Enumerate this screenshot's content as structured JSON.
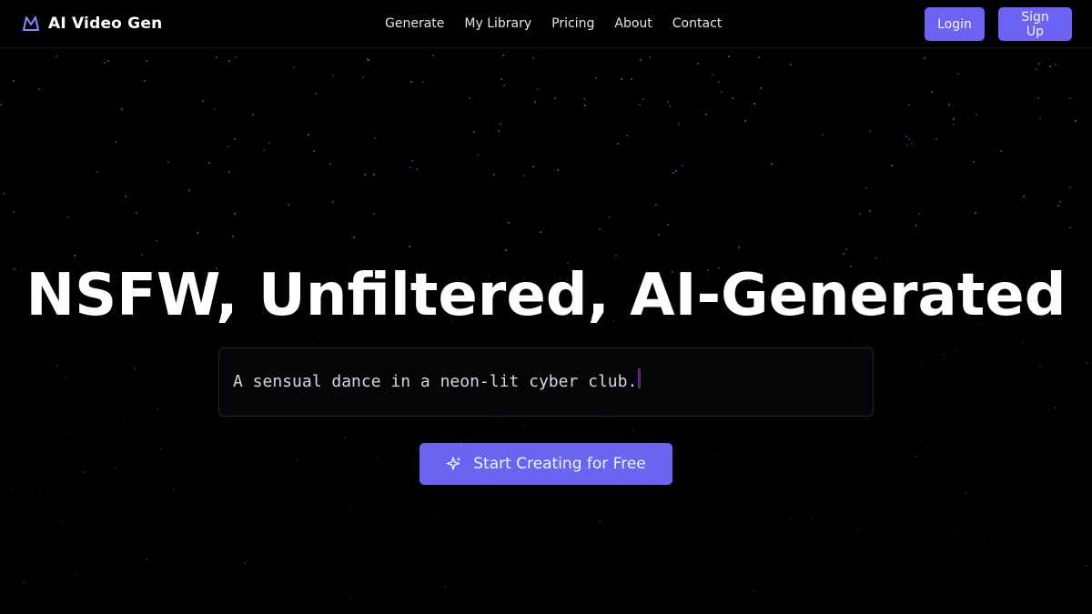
{
  "brand": {
    "name": "AI Video Gen",
    "logo_icon": "mountain-logo-icon"
  },
  "nav": {
    "items": [
      {
        "label": "Generate"
      },
      {
        "label": "My Library"
      },
      {
        "label": "Pricing"
      },
      {
        "label": "About"
      },
      {
        "label": "Contact"
      }
    ]
  },
  "auth": {
    "login_label": "Login",
    "signup_label": "Sign Up"
  },
  "hero": {
    "title": "NSFW, Unfiltered, AI-Generated",
    "prompt_text": "A sensual dance in a neon-lit cyber club.",
    "cta_label": "Start Creating for Free",
    "cta_icon": "sparkle-icon"
  },
  "colors": {
    "background": "#000000",
    "accent": "#6d63f2",
    "star": "#4b59c8"
  }
}
